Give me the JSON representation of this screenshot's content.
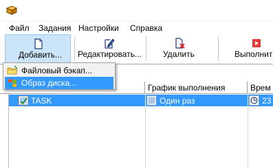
{
  "menu": {
    "items": [
      "Файл",
      "Задания",
      "Настройки",
      "Справка"
    ]
  },
  "toolbar": {
    "add_label": "Добавить...",
    "edit_label": "Редактировать...",
    "delete_label": "Удалить",
    "run_label": "Выполнит"
  },
  "dropdown": {
    "items": [
      {
        "label": "Файловый бэкап...",
        "icon": "folder-icon"
      },
      {
        "label": "Образ диска...",
        "icon": "windows-logo-icon"
      }
    ]
  },
  "table": {
    "columns": [
      "",
      "График выполнения",
      "Врем"
    ],
    "rows": [
      {
        "name": "TASK",
        "schedule": "Один раз",
        "time": "23"
      }
    ]
  },
  "colors": {
    "selection": "#3399ff",
    "pressed": "#cce4f7",
    "delete_red": "#e02020",
    "run_red": "#e53935"
  }
}
